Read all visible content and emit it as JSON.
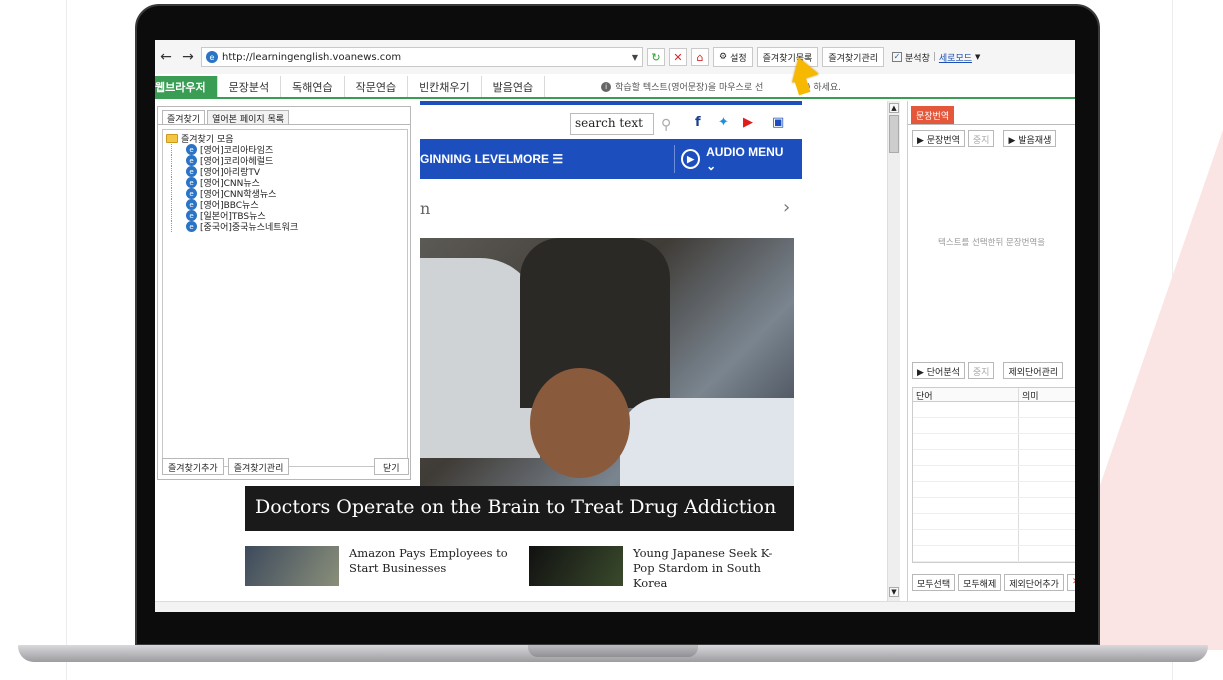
{
  "toolbar": {
    "url": "http://learningenglish.voanews.com",
    "settings_label": "설정",
    "fav_list_label": "즐겨찾기목록",
    "fav_manage_label": "즐겨찾기관리",
    "analysis_window_label": "분석창",
    "separator": "|",
    "view_mode_label": "세로모드",
    "analysis_checked": "✓"
  },
  "tabs": [
    {
      "label": "웹브라우저"
    },
    {
      "label": "문장분석"
    },
    {
      "label": "독해연습"
    },
    {
      "label": "작문연습"
    },
    {
      "label": "빈칸채우기"
    },
    {
      "label": "발음연습"
    }
  ],
  "hint": {
    "text": "학습할 텍스트(영어문장)을 마우스로 선",
    "tail": "g) 하세요."
  },
  "web": {
    "search_placeholder": "search text",
    "nav_level": "GINNING LEVEL",
    "nav_more": "MORE ☰",
    "audio_menu": "AUDIO MENU ⌄",
    "section_fragment": "n",
    "hero_caption": "Doctors Operate on the Brain to Treat Drug Addiction",
    "stories": [
      {
        "title": "Amazon Pays Employees to Start Businesses"
      },
      {
        "title": "Young Japanese Seek K-Pop Stardom in South Korea"
      }
    ]
  },
  "favorites": {
    "tab_favorites": "즐겨찾기",
    "tab_history": "열어본 페이지 목록",
    "root_label": "즐겨찾기 모음",
    "items": [
      {
        "label": "[영어]코리아타임즈"
      },
      {
        "label": "[영어]코리아헤럴드"
      },
      {
        "label": "[영어]아리랑TV"
      },
      {
        "label": "[영어]CNN뉴스"
      },
      {
        "label": "[영어]CNN학생뉴스"
      },
      {
        "label": "[영어]BBC뉴스"
      },
      {
        "label": "[일본어]TBS뉴스"
      },
      {
        "label": "[중국어]중국뉴스네트워크"
      }
    ],
    "add_label": "즐겨찾기추가",
    "manage_label": "즐겨찾기관리",
    "close_label": "닫기"
  },
  "right_panel": {
    "title": "문장번역",
    "translate_btn": "▶ 문장번역",
    "stop_btn": "중지",
    "pronounce_btn": "▶ 발음재생",
    "placeholder": "텍스트를 선택한뒤 문장번역을",
    "word_analysis_btn": "▶ 단어분석",
    "word_stop_btn": "중지",
    "exclude_manage_btn": "제외단어관리",
    "col_word": "단어",
    "col_meaning": "의미",
    "select_all_btn": "모두선택",
    "deselect_all_btn": "모두해제",
    "add_exclude_btn": "제외단어추가",
    "close_glyph": "✕"
  },
  "colors": {
    "accent_green": "#3a9d54",
    "voa_blue": "#1c4fbd",
    "panel_red": "#e4573a",
    "cursor_yellow": "#f6b800"
  }
}
